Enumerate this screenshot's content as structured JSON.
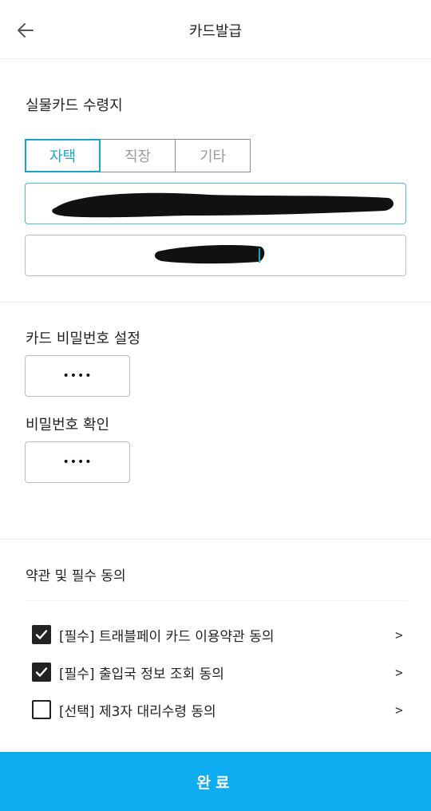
{
  "header": {
    "title": "카드발급",
    "back_icon": "back-arrow-icon"
  },
  "delivery": {
    "title": "실물카드 수령지",
    "tabs": [
      {
        "label": "자택",
        "active": true
      },
      {
        "label": "직장",
        "active": false
      },
      {
        "label": "기타",
        "active": false
      }
    ],
    "address_line1": "",
    "address_line2": ""
  },
  "password": {
    "title": "카드 비밀번호 설정",
    "value": "••••",
    "confirm_title": "비밀번호 확인",
    "confirm_value": "••••"
  },
  "agreements": {
    "title": "약관 및 필수 동의",
    "items": [
      {
        "label": "[필수] 트래블페이 카드 이용약관 동의",
        "checked": true
      },
      {
        "label": "[필수] 출입국 정보 조회 동의",
        "checked": true
      },
      {
        "label": "[선택] 제3자 대리수령 동의",
        "checked": false
      }
    ]
  },
  "footer": {
    "complete_label": "완료"
  },
  "colors": {
    "accent": "#1aa3c8",
    "primary_button": "#0eacf0"
  }
}
